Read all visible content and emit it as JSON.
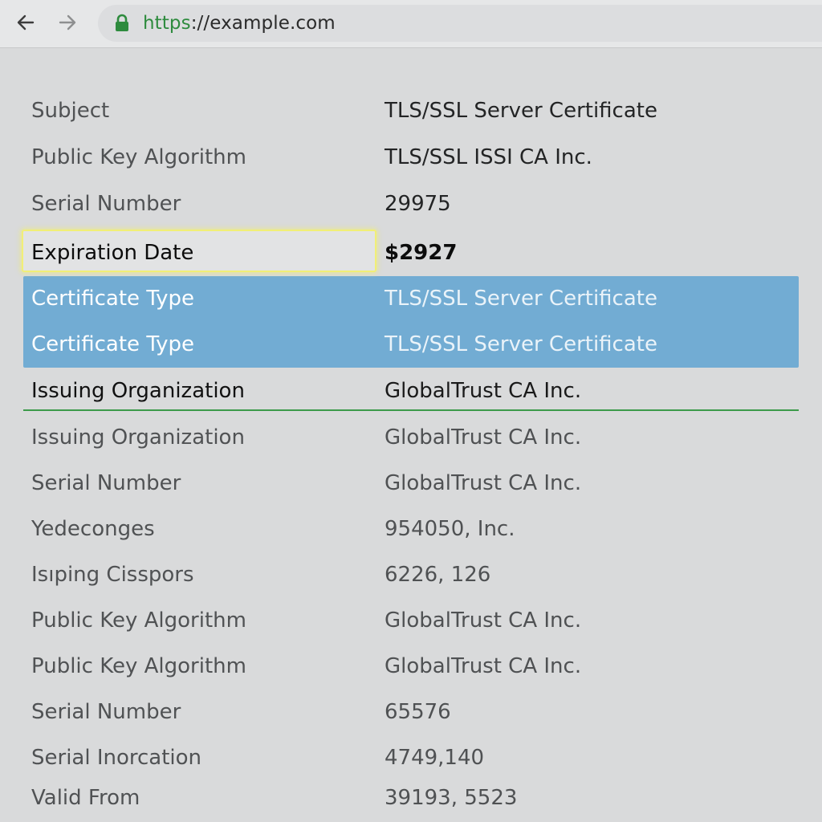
{
  "browser": {
    "url_scheme": "https",
    "url_rest": "://example.com",
    "colors": {
      "lock": "#2e8b3e",
      "scheme": "#2e8b3e",
      "selection": "#72acd3",
      "focus_outline": "#f1ef77",
      "divider": "#3c9a4a"
    },
    "icons": {
      "back": "arrow-left-icon",
      "forward": "arrow-right-icon",
      "lock": "lock-icon"
    }
  },
  "rows": [
    {
      "label": "Subject",
      "value": "TLS/SSL Server Certificate"
    },
    {
      "label": "Public Key Algorithm",
      "value": "TLS/SSL ISSI CA Inc."
    },
    {
      "label": "Serial Number",
      "value": "29975"
    },
    {
      "label": "Expiration Date",
      "value": "$2927"
    },
    {
      "label": "Certificate Type",
      "value": "TLS/SSL Server Certificate"
    },
    {
      "label": "Certificate Type",
      "value": "TLS/SSL Server Certificate"
    },
    {
      "label": "Issuing Organization",
      "value": "GlobalTrust CA Inc."
    },
    {
      "label": "Issuing Organization",
      "value": "GlobalTrust CA Inc."
    },
    {
      "label": "Serial Number",
      "value": "GlobalTrust CA Inc."
    },
    {
      "label": "Yedeconges",
      "value": "954050, Inc."
    },
    {
      "label": "Isıping Cisspors",
      "value": "6226, 126"
    },
    {
      "label": "Public Key Algorithm",
      "value": "GlobalTrust CA Inc."
    },
    {
      "label": "Public Key Algorithm",
      "value": "GlobalTrust CA Inc."
    },
    {
      "label": "Serial Number",
      "value": "65576"
    },
    {
      "label": "Serial Inorcation",
      "value": "4749,140"
    },
    {
      "label": "Valid From",
      "value": "39193, 5523"
    }
  ]
}
